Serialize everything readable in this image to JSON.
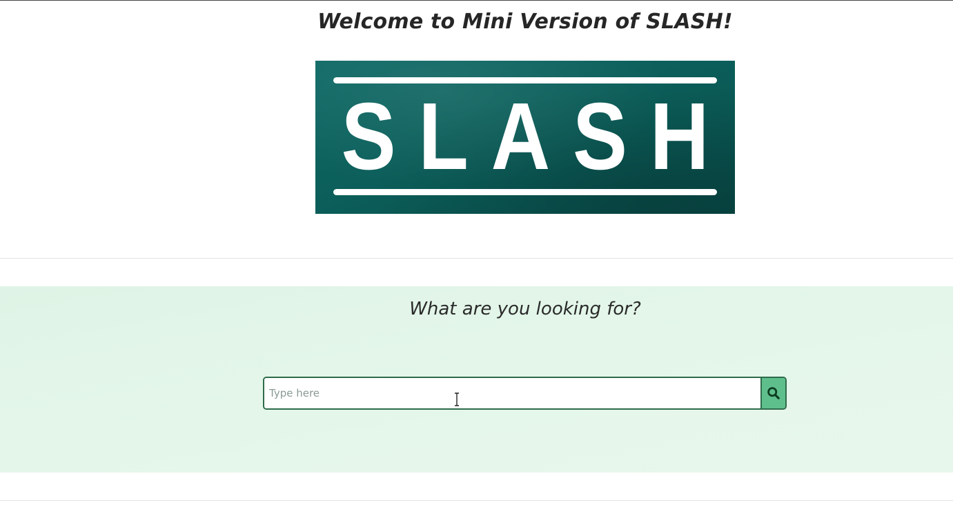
{
  "header": {
    "title": "Welcome to Mini Version of SLASH!"
  },
  "logo": {
    "text": "SLASH",
    "background_color": "#0b5c58",
    "text_color": "#ffffff"
  },
  "search": {
    "heading": "What are you looking for?",
    "placeholder": "Type here",
    "value": "",
    "button_icon": "search-icon",
    "section_background": "#e2f5e8",
    "button_color": "#5fbf8c",
    "border_color": "#2e6b4a"
  }
}
